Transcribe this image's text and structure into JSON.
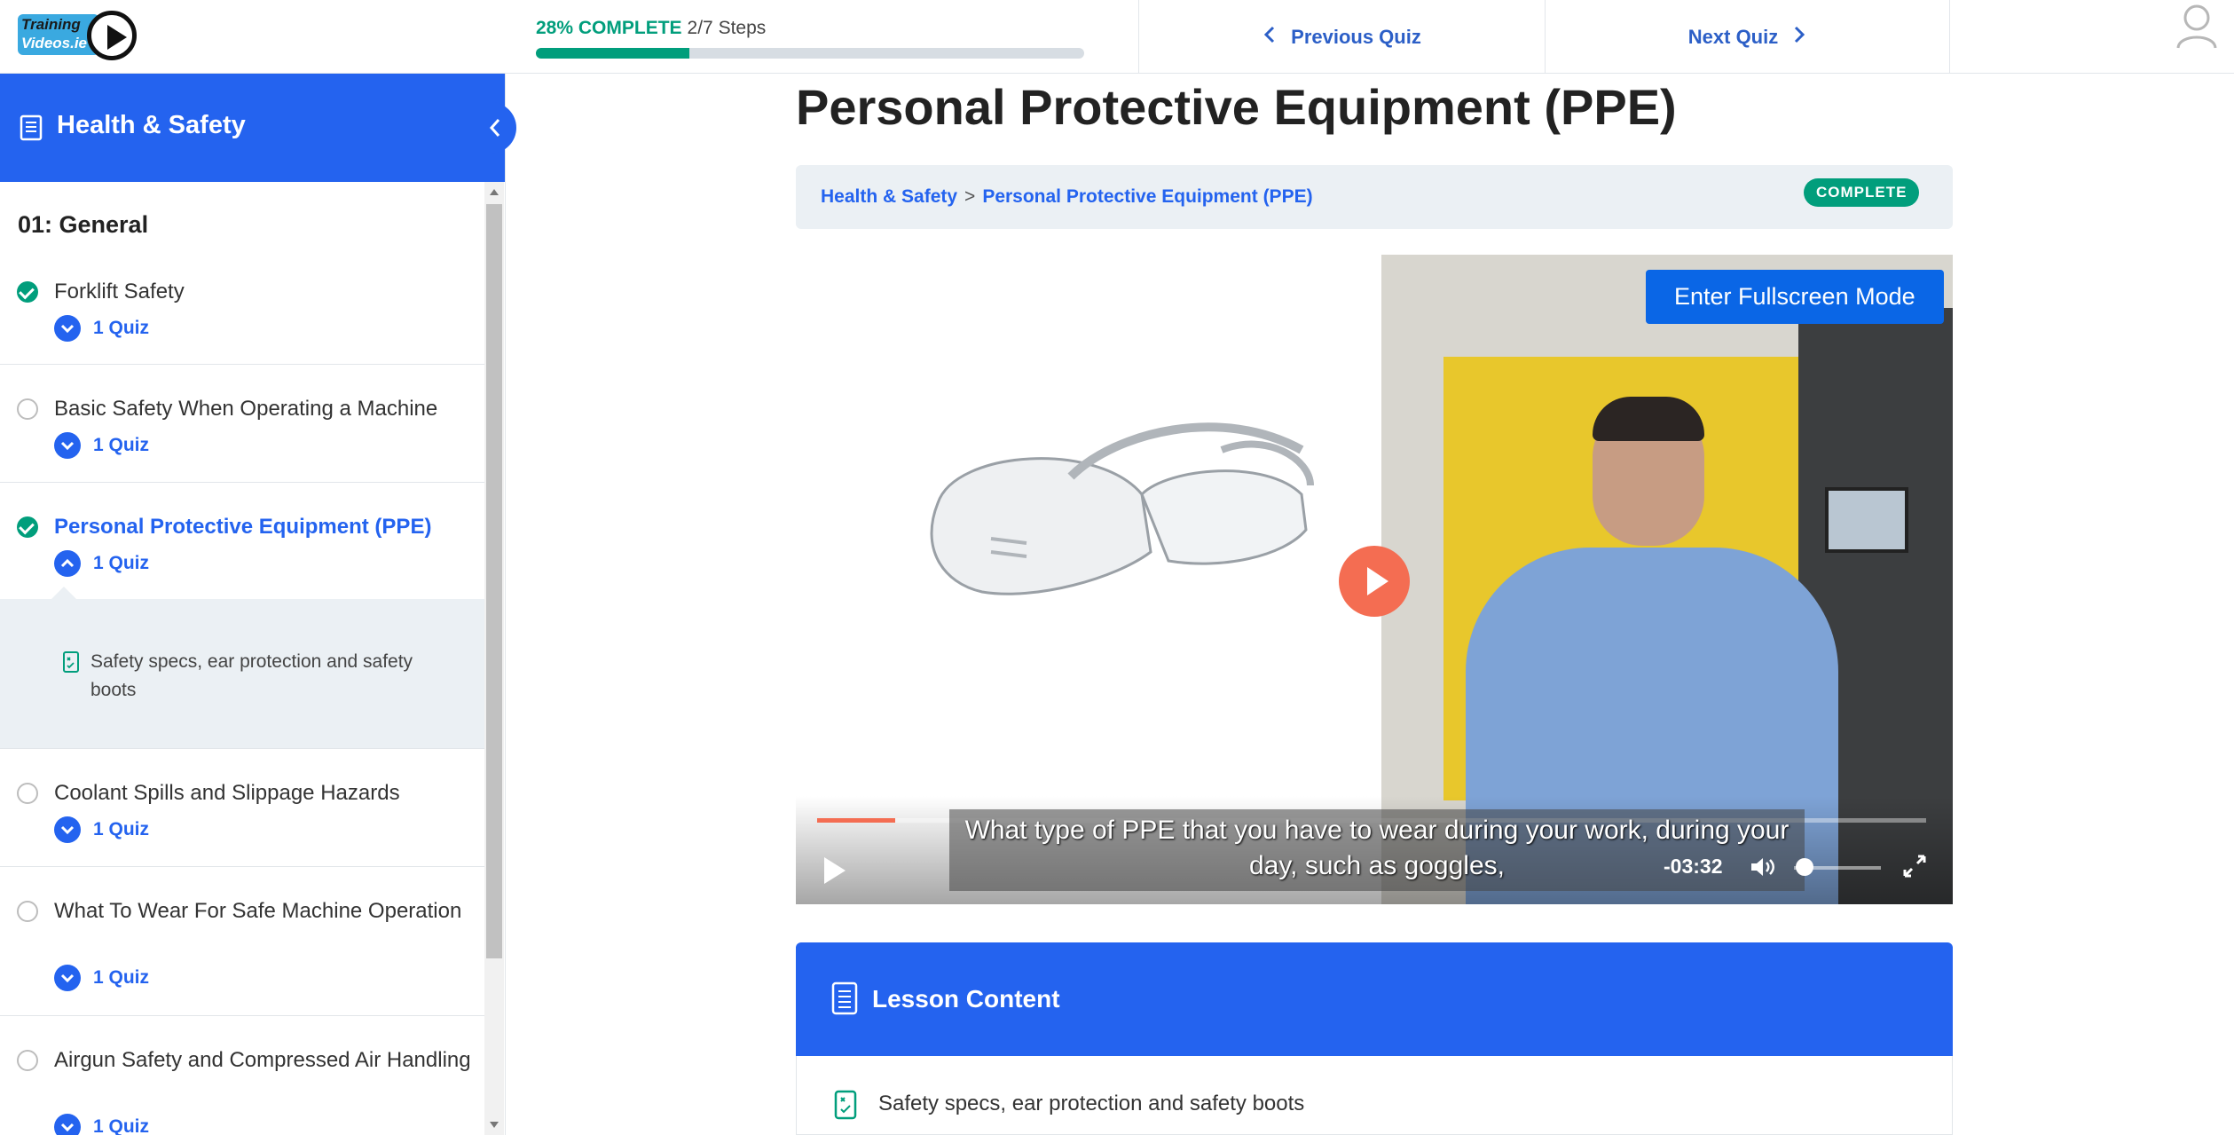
{
  "header": {
    "logo_line1": "Training",
    "logo_line2": "Videos.ie",
    "progress_percent_label": "28% COMPLETE",
    "progress_steps": "2/7 Steps",
    "progress_fraction": 0.28,
    "prev_label": "Previous Quiz",
    "next_label": "Next Quiz"
  },
  "sidebar": {
    "course_title": "Health & Safety",
    "section_title": "01: General",
    "lessons": [
      {
        "name": "Forklift Safety",
        "status": "complete",
        "quiz": "1 Quiz"
      },
      {
        "name": "Basic Safety When Operating a Machine",
        "status": "incomplete",
        "quiz": "1 Quiz"
      },
      {
        "name": "Personal Protective Equipment (PPE)",
        "status": "complete",
        "quiz": "1 Quiz",
        "expanded": true
      },
      {
        "name": "Coolant Spills and Slippage Hazards",
        "status": "incomplete",
        "quiz": "1 Quiz"
      },
      {
        "name": "What To Wear For Safe Machine Operation",
        "status": "incomplete",
        "quiz": "1 Quiz"
      },
      {
        "name": "Airgun Safety and Compressed Air Handling",
        "status": "incomplete",
        "quiz": "1 Quiz"
      }
    ],
    "expanded_quiz_item": "Safety specs, ear protection and safety boots"
  },
  "main": {
    "title": "Personal Protective Equipment (PPE)",
    "breadcrumb": [
      "Health & Safety",
      "Personal Protective Equipment (PPE)"
    ],
    "breadcrumb_separator": ">",
    "status_badge": "COMPLETE",
    "video": {
      "fullscreen_label": "Enter Fullscreen Mode",
      "caption": "What type of PPE that you have to wear during your work, during your day, such as goggles,",
      "time_remaining": "-03:32",
      "played_fraction": 0.07,
      "volume_fraction": 0.12
    },
    "lesson_content": {
      "title": "Lesson Content",
      "items": [
        "Safety specs, ear protection and safety boots"
      ]
    }
  },
  "colors": {
    "accent": "#2463ef",
    "complete": "#019e7c",
    "video_accent": "#f46d52"
  }
}
